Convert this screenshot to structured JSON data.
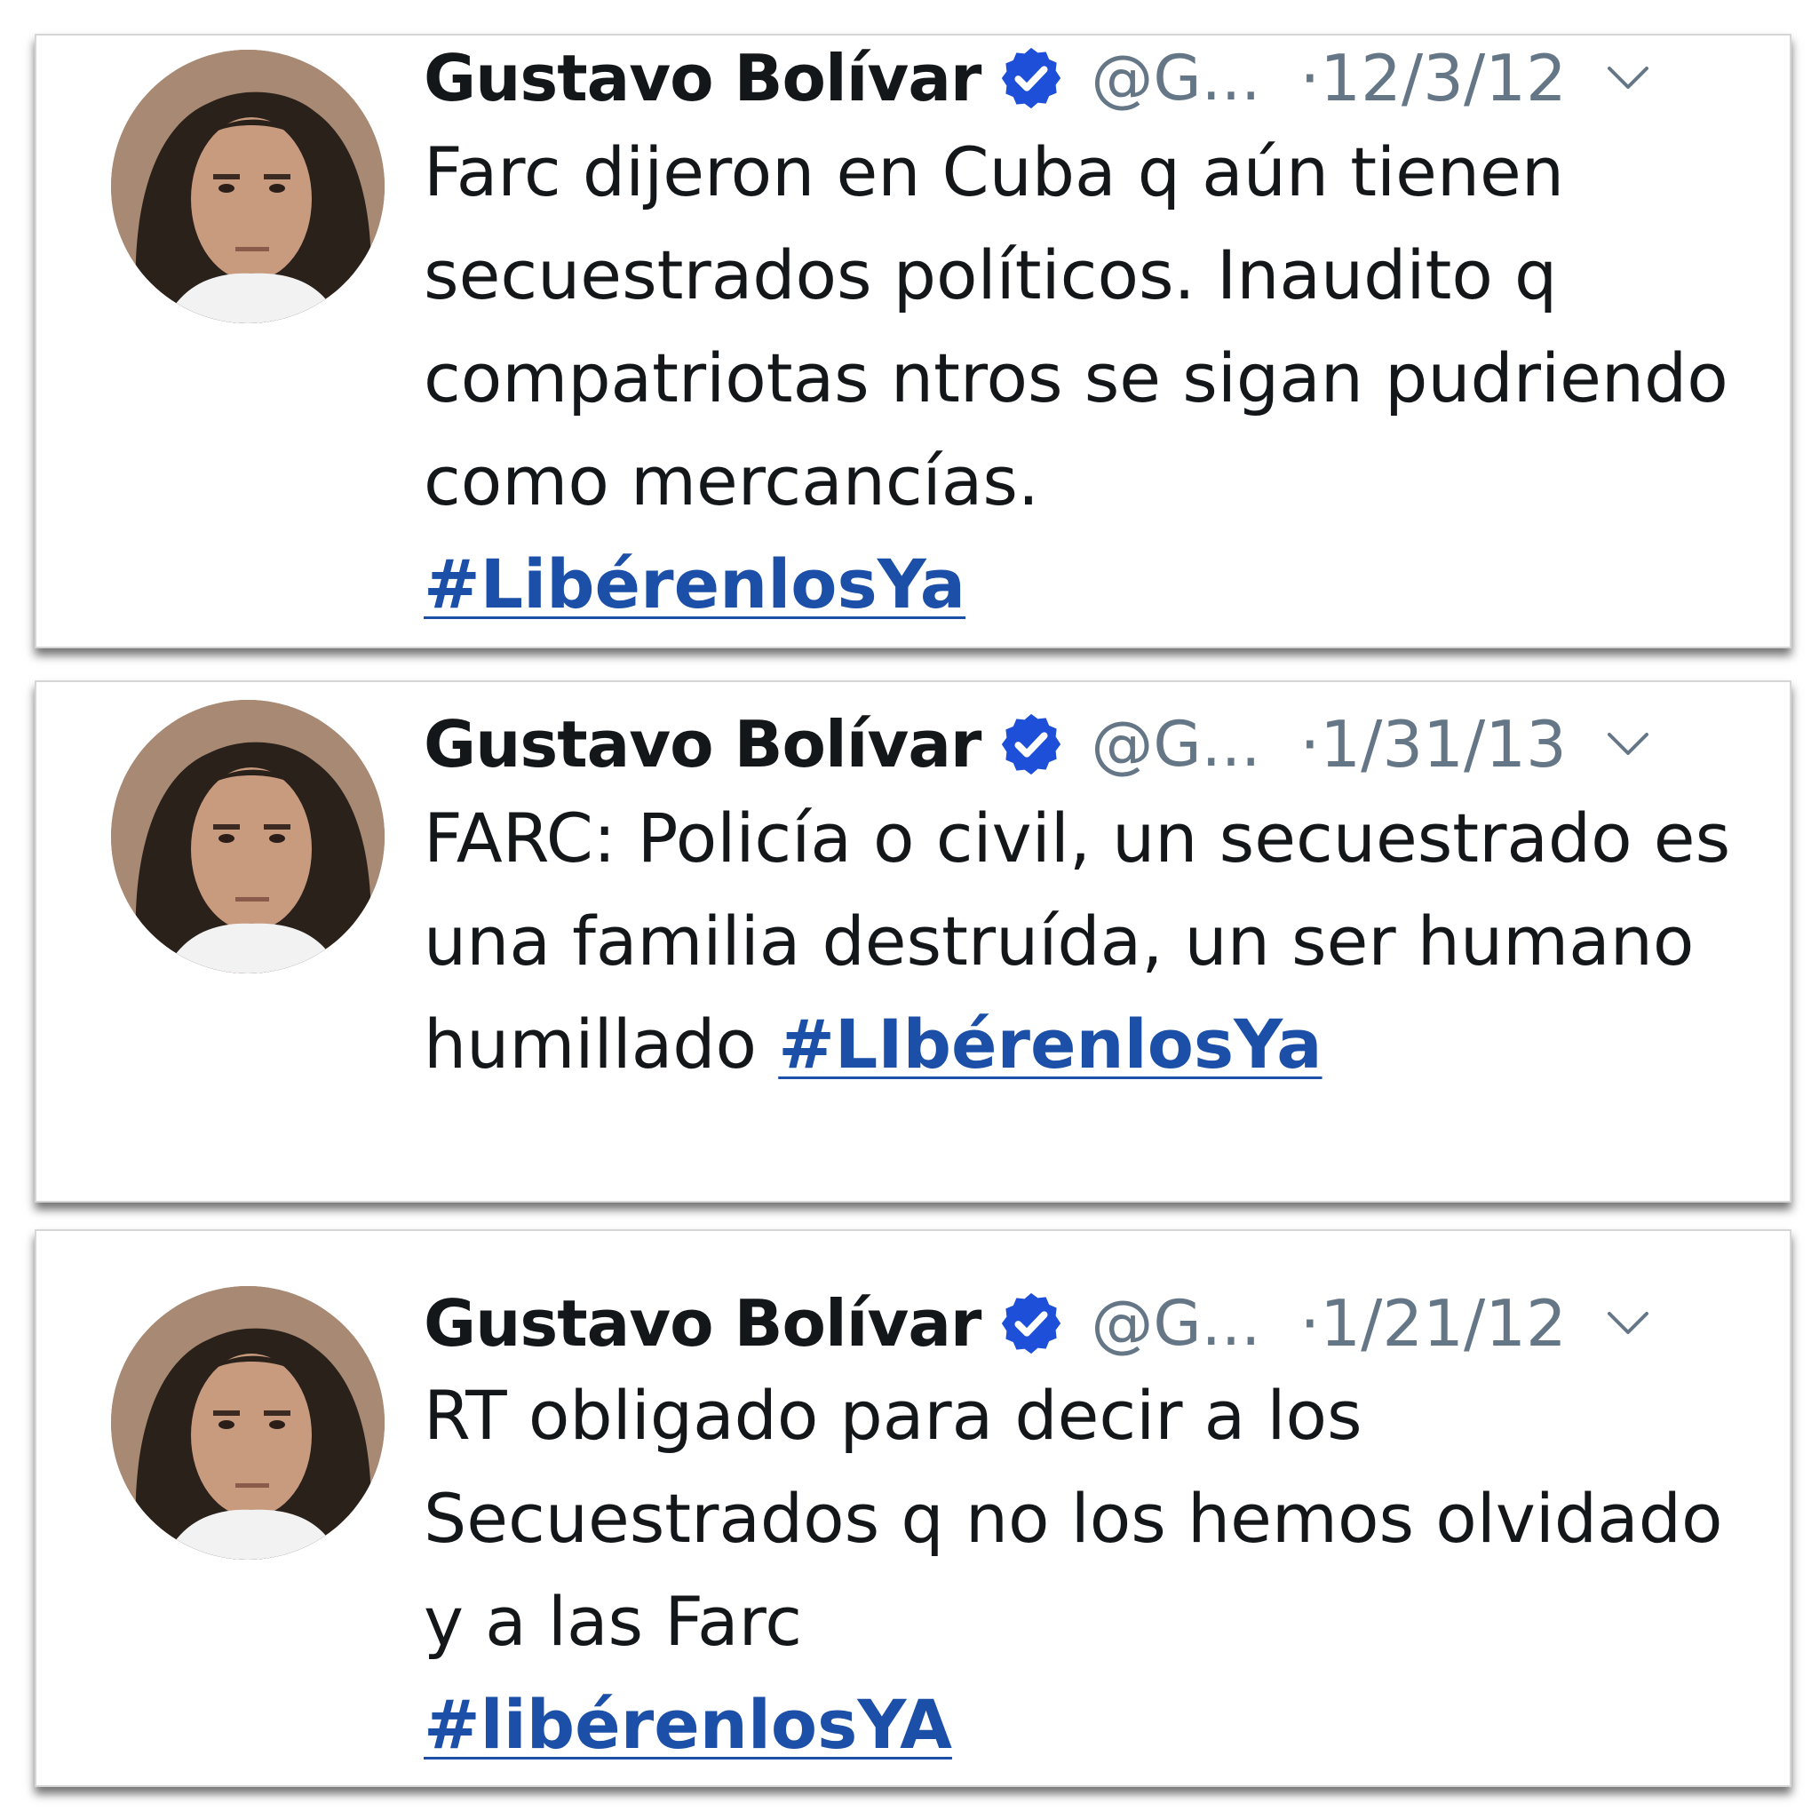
{
  "tweets": [
    {
      "name": "Gustavo Bolívar",
      "handle": "@G...",
      "date": "·12/3/12",
      "text": "Farc dijeron en Cuba q aún tienen secuestrados políticos. Inaudito q compatriotas ntros se sigan pudriendo como mercancías.",
      "hashtag": "#LibérenlosYa"
    },
    {
      "name": "Gustavo Bolívar",
      "handle": "@G...",
      "date": "·1/31/13",
      "text": "FARC: Policía o civil, un secuestrado es una familia destruída, un ser humano humillado",
      "hashtag": "#LIbérenlosYa"
    },
    {
      "name": "Gustavo Bolívar",
      "handle": "@G...",
      "date": "·1/21/12",
      "text": "RT obligado para decir a los Secuestrados q no los hemos olvidado y a las Farc",
      "hashtag": "#libérenlosYA"
    }
  ],
  "colors": {
    "name": "#14171a",
    "meta": "#657786",
    "verified_badge": "#1d4fd8",
    "hashtag": "#1b4fa8"
  },
  "icons": {
    "verified": "verified-badge-icon",
    "menu": "chevron-down-icon"
  }
}
